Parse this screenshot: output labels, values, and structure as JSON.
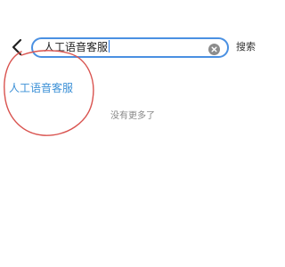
{
  "search": {
    "value": "人工语音客服",
    "button_label": "搜索"
  },
  "results": [
    {
      "label": "人工语音客服"
    }
  ],
  "footer": {
    "no_more_text": "没有更多了"
  },
  "icons": {
    "back": "chevron-left-icon",
    "clear": "clear-circle-icon"
  },
  "colors": {
    "accent": "#4a90e2",
    "result_link": "#3a8fd6",
    "annotation": "#d9534f"
  }
}
